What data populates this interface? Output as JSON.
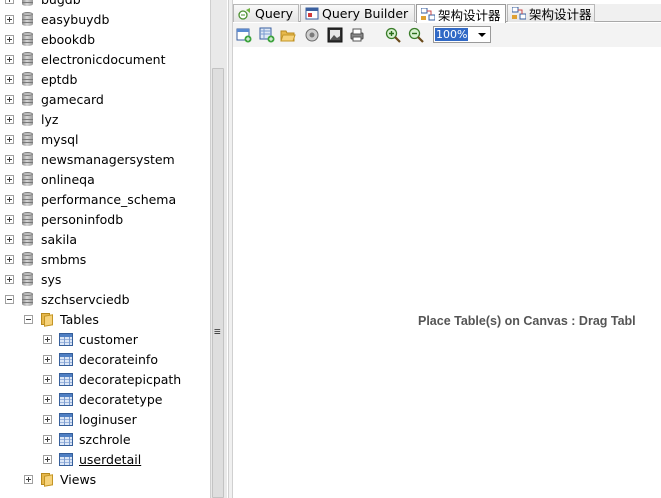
{
  "tree": {
    "databases": [
      "bugdb",
      "easybuydb",
      "ebookdb",
      "electronicdocument",
      "eptdb",
      "gamecard",
      "lyz",
      "mysql",
      "newsmanagersystem",
      "onlineqa",
      "performance_schema",
      "personinfodb",
      "sakila",
      "smbms",
      "sys",
      "szchservciedb"
    ],
    "tables_folder": "Tables",
    "tables": [
      "customer",
      "decorateinfo",
      "decoratepicpath",
      "decoratetype",
      "loginuser",
      "szchrole",
      "userdetail"
    ],
    "selected_table": "userdetail",
    "views_folder": "Views"
  },
  "tabs": [
    {
      "label": "Query",
      "icon": "query-icon"
    },
    {
      "label": "Query Builder",
      "icon": "query-builder-icon"
    },
    {
      "label": "架构设计器",
      "icon": "schema-designer-icon",
      "active": true
    },
    {
      "label": "架构设计器",
      "icon": "schema-designer-icon"
    }
  ],
  "toolbar": {
    "icons": [
      "new-schema-icon",
      "add-table-icon",
      "open-folder-icon",
      "save-icon",
      "export-image-icon",
      "print-icon",
      "zoom-in-icon",
      "zoom-out-icon"
    ],
    "zoom": "100%"
  },
  "canvas": {
    "hint": "Place Table(s) on Canvas : Drag Tabl"
  },
  "colors": {
    "selection": "#3169c6",
    "panel_bg": "#f0f0f0"
  }
}
